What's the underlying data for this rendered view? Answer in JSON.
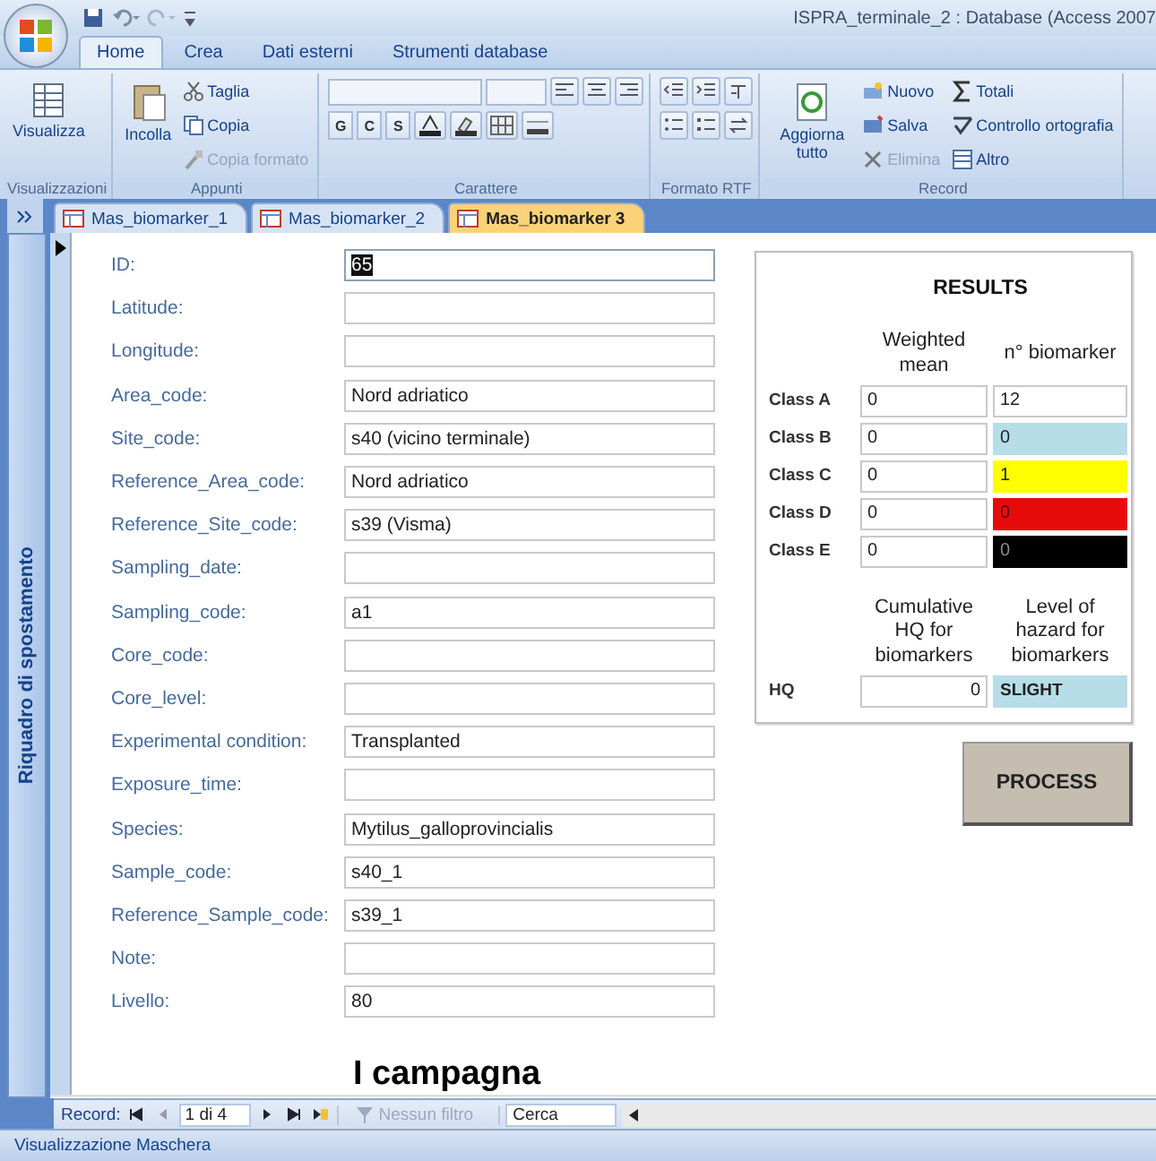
{
  "window": {
    "title": "ISPRA_terminale_2 : Database (Access 2007"
  },
  "ribbon_tabs": [
    {
      "label": "Home",
      "selected": true
    },
    {
      "label": "Crea",
      "selected": false
    },
    {
      "label": "Dati esterni",
      "selected": false
    },
    {
      "label": "Strumenti database",
      "selected": false
    }
  ],
  "ribbon_groups": [
    {
      "label": "Visualizzazioni",
      "columns": [
        [
          [
            {
              "kind": "large",
              "label": "Visualizza",
              "disabled": false
            }
          ]
        ]
      ]
    },
    {
      "label": "Appunti",
      "columns": [
        [
          [
            {
              "kind": "large",
              "label": "Incolla",
              "disabled": false
            }
          ]
        ],
        [
          [
            {
              "kind": "small",
              "label": "Taglia",
              "disabled": false
            }
          ],
          [
            {
              "kind": "small",
              "label": "Copia",
              "disabled": false
            }
          ],
          [
            {
              "kind": "small",
              "label": "Copia formato",
              "disabled": true
            }
          ]
        ]
      ]
    },
    {
      "label": "Carattere",
      "columns": [
        [
          [
            {
              "kind": "font-combo"
            },
            {
              "kind": "size-combo"
            },
            {
              "kind": "tool"
            },
            {
              "kind": "tool"
            },
            {
              "kind": "tool"
            }
          ],
          [
            {
              "kind": "letter",
              "label": "G"
            },
            {
              "kind": "letter",
              "label": "C"
            },
            {
              "kind": "letter",
              "label": "S"
            },
            {
              "kind": "tool"
            },
            {
              "kind": "tool"
            },
            {
              "kind": "tool"
            },
            {
              "kind": "tool"
            }
          ]
        ]
      ]
    },
    {
      "label": "Formato RTF",
      "columns": [
        [
          [
            {
              "kind": "tool"
            },
            {
              "kind": "tool"
            },
            {
              "kind": "tool"
            }
          ],
          [
            {
              "kind": "tool"
            },
            {
              "kind": "tool"
            },
            {
              "kind": "tool"
            }
          ]
        ]
      ]
    },
    {
      "label": "Record",
      "columns": [
        [
          [
            {
              "kind": "large",
              "label": "Aggiorna tutto",
              "disabled": false
            }
          ]
        ],
        [
          [
            {
              "kind": "small",
              "label": "Nuovo",
              "disabled": false
            }
          ],
          [
            {
              "kind": "small",
              "label": "Salva",
              "disabled": false
            }
          ],
          [
            {
              "kind": "small",
              "label": "Elimina",
              "disabled": true
            }
          ]
        ],
        [
          [
            {
              "kind": "small",
              "label": "Totali",
              "disabled": false
            }
          ],
          [
            {
              "kind": "small",
              "label": "Controllo ortografia",
              "disabled": false
            }
          ],
          [
            {
              "kind": "small",
              "label": "Altro",
              "disabled": false
            }
          ]
        ]
      ]
    }
  ],
  "doc_tabs": [
    {
      "label": "Mas_biomarker_1",
      "selected": false
    },
    {
      "label": "Mas_biomarker_2",
      "selected": false
    },
    {
      "label": "Mas_biomarker 3",
      "selected": true
    }
  ],
  "nav_pane": {
    "title": "Riquadro di spostamento"
  },
  "form_fields": [
    {
      "label": "ID:",
      "value": "65",
      "selected": true
    },
    {
      "label": "Latitude:",
      "selected": false
    },
    {
      "label": "Longitude:",
      "selected": false
    },
    {
      "label": "Area_code:",
      "value": "Nord adriatico",
      "selected": false
    },
    {
      "label": "Site_code:",
      "value": "s40 (vicino terminale)",
      "selected": false
    },
    {
      "label": "Reference_Area_code:",
      "value": "Nord adriatico",
      "selected": false
    },
    {
      "label": "Reference_Site_code:",
      "value": "s39 (Visma)",
      "selected": false
    },
    {
      "label": "Sampling_date:",
      "selected": false
    },
    {
      "label": "Sampling_code:",
      "value": "a1",
      "selected": false
    },
    {
      "label": "Core_code:",
      "selected": false
    },
    {
      "label": "Core_level:",
      "selected": false
    },
    {
      "label": "Experimental condition:",
      "value": "Transplanted",
      "selected": false
    },
    {
      "label": "Exposure_time:",
      "selected": false
    },
    {
      "label": "Species:",
      "value": "Mytilus_galloprovincialis",
      "selected": false
    },
    {
      "label": "Sample_code:",
      "value": "s40_1",
      "selected": false
    },
    {
      "label": "Reference_Sample_code:",
      "value": "s39_1",
      "selected": false
    },
    {
      "label": "Note:",
      "selected": false
    },
    {
      "label": "Livello:",
      "value": "80",
      "selected": false
    }
  ],
  "caption": "I campagna",
  "results": {
    "title": "RESULTS",
    "headers": [
      "Weighted mean",
      "n° biomarker"
    ],
    "classes": [
      {
        "label": "Class A",
        "weighted_mean": "0",
        "count": "12",
        "color": "#ffffff"
      },
      {
        "label": "Class B",
        "weighted_mean": "0",
        "count": "0",
        "color": "#b7dde8"
      },
      {
        "label": "Class C",
        "weighted_mean": "0",
        "count": "1",
        "color": "#ffff00"
      },
      {
        "label": "Class D",
        "weighted_mean": "0",
        "count": "0",
        "color": "#e60b0b"
      },
      {
        "label": "Class E",
        "weighted_mean": "0",
        "count": "0",
        "color": "#000000"
      }
    ],
    "hq_headers": [
      "Cumulative HQ for biomarkers",
      "Level of hazard for biomarkers"
    ],
    "hq": {
      "label": "HQ",
      "value": "0",
      "hazard": "SLIGHT",
      "color": "#b7dde8"
    }
  },
  "process_button": "PROCESS",
  "record_nav": {
    "label": "Record:",
    "position": "1 di 4",
    "filter": "Nessun filtro",
    "search": "Cerca"
  },
  "status_bar": "Visualizzazione Maschera"
}
